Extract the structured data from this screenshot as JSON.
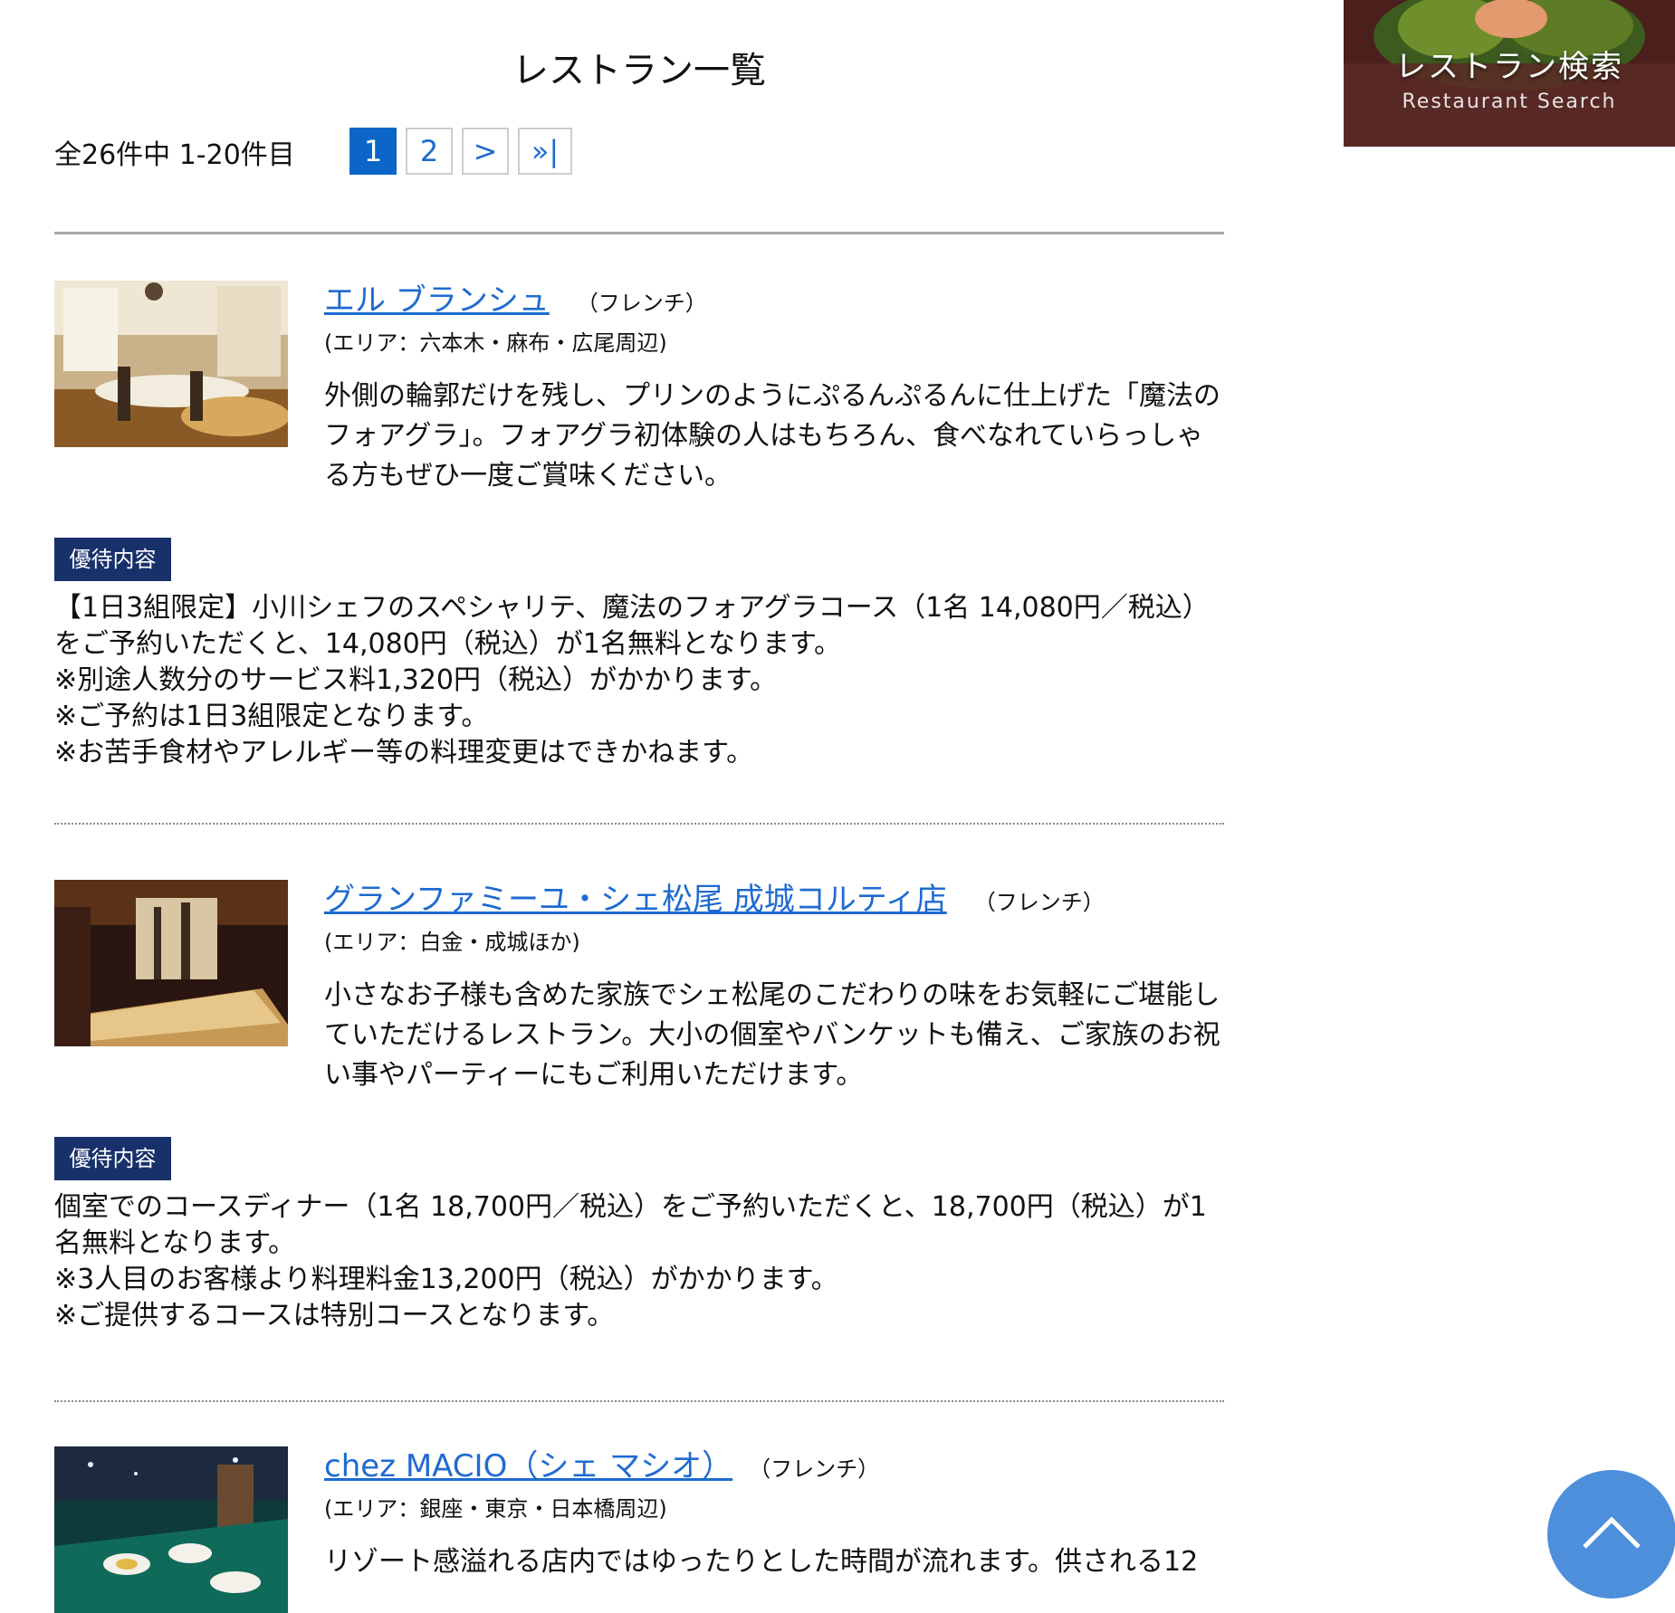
{
  "header": {
    "title": "レストラン一覧"
  },
  "results": {
    "count_label": "全26件中 1-20件目"
  },
  "pagination": {
    "current": "1",
    "next_page": "2",
    "next": ">",
    "last": "»|"
  },
  "restaurants": [
    {
      "name": "エル ブランシュ",
      "genre": "（フレンチ）",
      "area": "(エリア：六本木・麻布・広尾周辺)",
      "description": "外側の輪郭だけを残し、プリンのようにぷるんぷるんに仕上げた「魔法のフォアグラ」。フォアグラ初体験の人はもちろん、食べなれていらっしゃる方もぜひ一度ご賞味ください。",
      "benefit_label": "優待内容",
      "benefit_lines": [
        "【1日3組限定】小川シェフのスペシャリテ、魔法のフォアグラコース（1名 14,080円／税込）",
        "をご予約いただくと、14,080円（税込）が1名無料となります。",
        "※別途人数分のサービス料1,320円（税込）がかかります。",
        "※ご予約は1日3組限定となります。",
        "※お苦手食材やアレルギー等の料理変更はできかねます。"
      ]
    },
    {
      "name": "グランファミーユ・シェ松尾 成城コルティ店",
      "genre": "（フレンチ）",
      "area": "(エリア：白金・成城ほか)",
      "description": "小さなお子様も含めた家族でシェ松尾のこだわりの味をお気軽にご堪能していただけるレストラン。大小の個室やバンケットも備え、ご家族のお祝い事やパーティーにもご利用いただけます。",
      "benefit_label": "優待内容",
      "benefit_lines": [
        "個室でのコースディナー（1名 18,700円／税込）をご予約いただくと、18,700円（税込）が1",
        "名無料となります。",
        "※3人目のお客様より料理料金13,200円（税込）がかかります。",
        "※ご提供するコースは特別コースとなります。"
      ]
    },
    {
      "name": "chez MACIO（シェ マシオ）",
      "genre": "（フレンチ）",
      "area": "(エリア：銀座・東京・日本橋周辺)",
      "description": "リゾート感溢れる店内ではゆったりとした時間が流れます。供される12"
    }
  ],
  "sidebar": {
    "search_title": "レストラン検索",
    "search_subtitle": "Restaurant Search"
  },
  "icons": {
    "back_to_top": "chevron-up-icon",
    "search_banner_image": "salad-dish-photo"
  },
  "colors": {
    "link": "#1f6bd1",
    "pager_active": "#0b66c8",
    "benefit_tag": "#18316b",
    "back_to_top": "#4e8fdb"
  }
}
